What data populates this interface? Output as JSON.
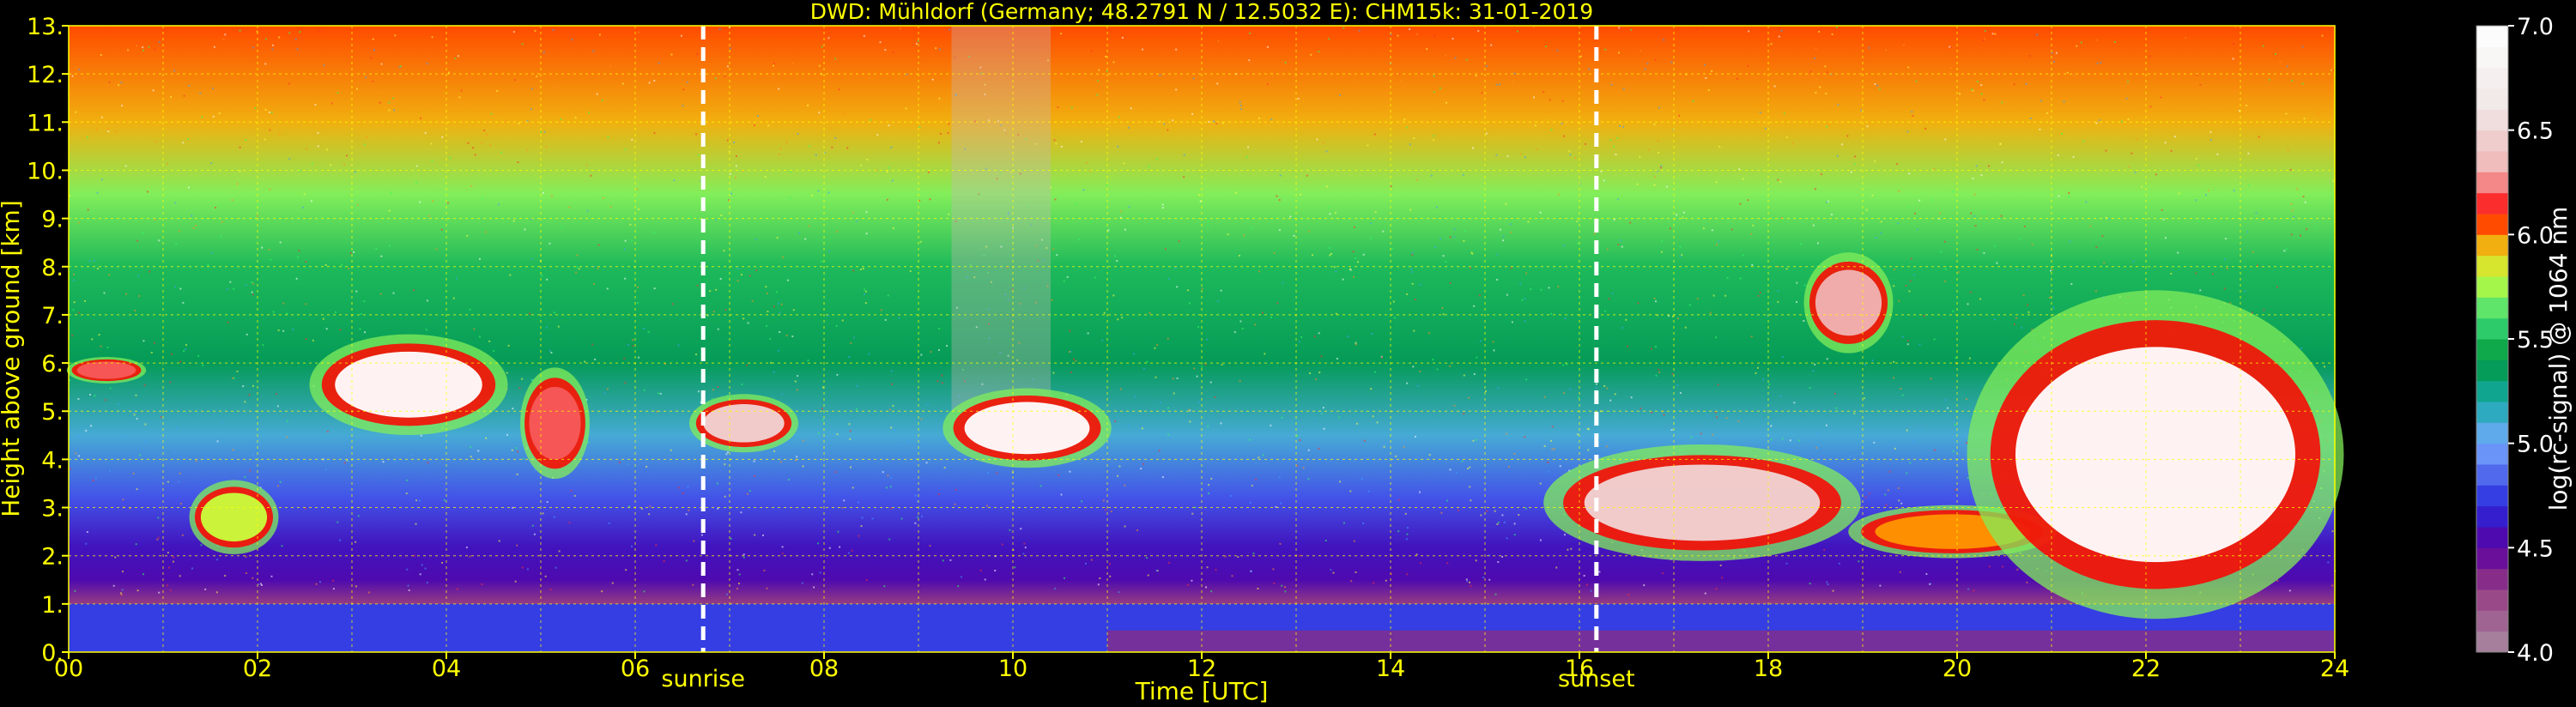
{
  "chart_data": {
    "type": "heatmap",
    "title": "DWD: Mühldorf (Germany; 48.2791 N / 12.5032 E):    CHM15k: 31-01-2019",
    "xlabel": "Time [UTC]",
    "ylabel": "Height above ground [km]",
    "xlim": [
      0,
      24
    ],
    "ylim": [
      0,
      13
    ],
    "x_ticks": [
      "00",
      "02",
      "04",
      "06",
      "08",
      "10",
      "12",
      "14",
      "16",
      "18",
      "20",
      "22",
      "24"
    ],
    "y_ticks": [
      "0.",
      "1.",
      "2.",
      "3.",
      "4.",
      "5.",
      "6.",
      "7.",
      "8.",
      "9.",
      "10.",
      "11.",
      "12.",
      "13."
    ],
    "grid": true,
    "annotations": [
      {
        "label": "sunrise",
        "x": 6.72
      },
      {
        "label": "sunset",
        "x": 16.18
      }
    ],
    "colorbar": {
      "label": "log(rc-signal) @ 1064 nm",
      "range": [
        4.0,
        7.0
      ],
      "ticks": [
        "4.0",
        "4.5",
        "5.0",
        "5.5",
        "6.0",
        "6.5",
        "7.0"
      ]
    },
    "cloud_layers": [
      {
        "t0": 0.0,
        "t1": 0.8,
        "h_base": 5.6,
        "h_top": 6.1,
        "intensity": 6.2
      },
      {
        "t0": 1.3,
        "t1": 2.2,
        "h_base": 2.1,
        "h_top": 3.5,
        "intensity": 5.8
      },
      {
        "t0": 2.6,
        "t1": 4.6,
        "h_base": 4.6,
        "h_top": 6.5,
        "intensity": 7.0
      },
      {
        "t0": 4.8,
        "t1": 5.5,
        "h_base": 3.7,
        "h_top": 5.8,
        "intensity": 6.2
      },
      {
        "t0": 6.6,
        "t1": 7.7,
        "h_base": 4.2,
        "h_top": 5.3,
        "intensity": 6.5
      },
      {
        "t0": 9.3,
        "t1": 11.0,
        "h_base": 3.9,
        "h_top": 5.4,
        "intensity": 7.0
      },
      {
        "t0": 15.7,
        "t1": 18.9,
        "h_base": 2.0,
        "h_top": 4.2,
        "intensity": 6.5
      },
      {
        "t0": 18.9,
        "t1": 21.0,
        "h_base": 2.0,
        "h_top": 3.0,
        "intensity": 6.0
      },
      {
        "t0": 18.4,
        "t1": 19.3,
        "h_base": 6.3,
        "h_top": 8.2,
        "intensity": 6.3
      },
      {
        "t0": 20.2,
        "t1": 24.0,
        "h_base": 1.0,
        "h_top": 7.2,
        "intensity": 7.0
      }
    ],
    "boundary_layer_top_km": 1.0
  }
}
